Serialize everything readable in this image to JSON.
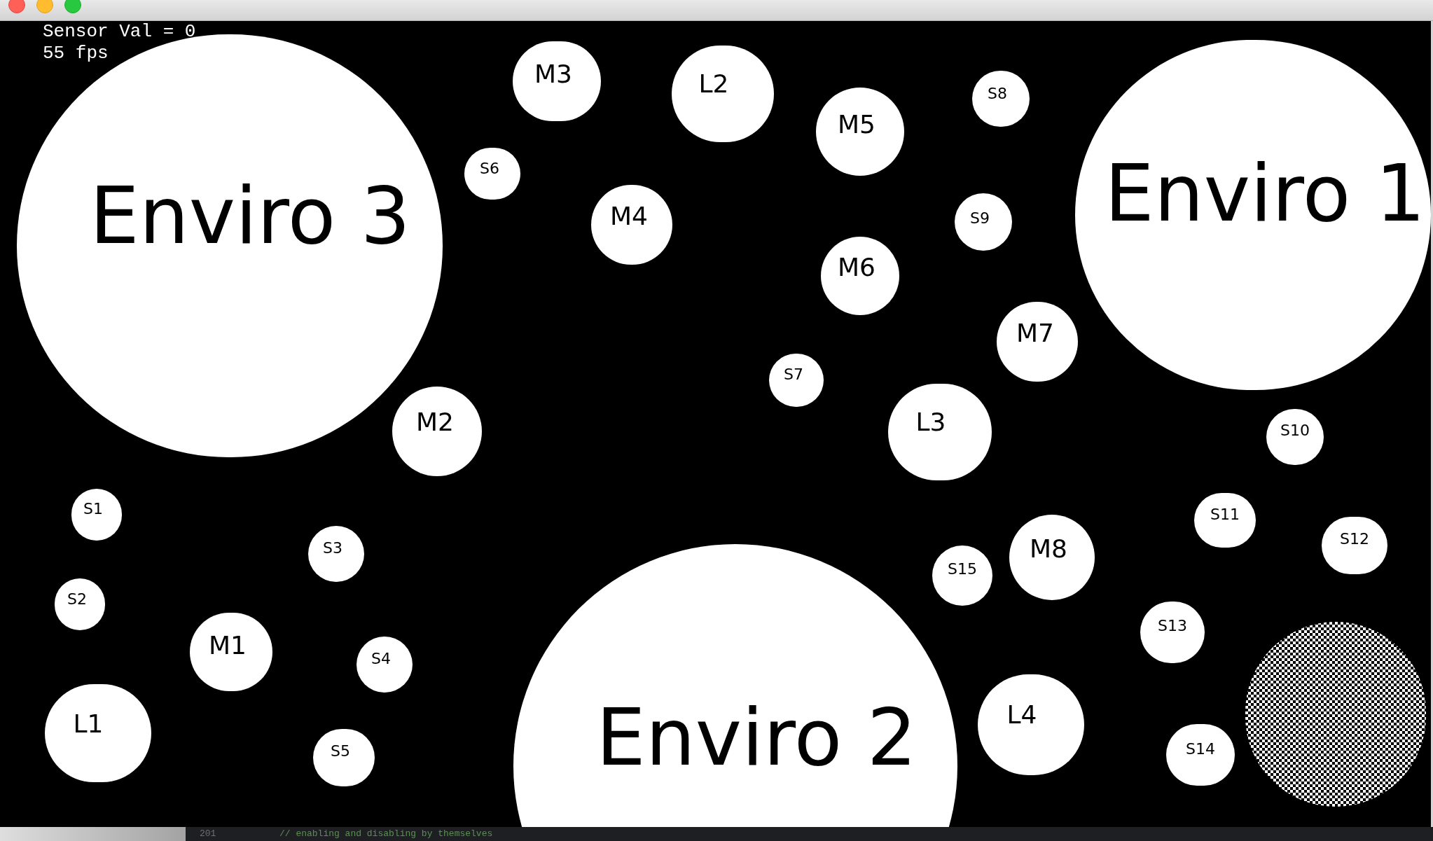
{
  "sketch": {
    "overlay_lines": [
      "Sensor Val = 0",
      "55 fps"
    ],
    "circles": [
      {
        "label": "M3",
        "kind": "medium"
      },
      {
        "label": "L2",
        "kind": "medium"
      },
      {
        "label": "S8",
        "kind": "small"
      },
      {
        "label": "M5",
        "kind": "medium"
      },
      {
        "label": "S6",
        "kind": "small"
      },
      {
        "label": "Enviro 3",
        "kind": "large"
      },
      {
        "label": "M4",
        "kind": "medium"
      },
      {
        "label": "S9",
        "kind": "small"
      },
      {
        "label": "Enviro 1",
        "kind": "large"
      },
      {
        "label": "M6",
        "kind": "medium"
      },
      {
        "label": "M7",
        "kind": "medium"
      },
      {
        "label": "S7",
        "kind": "small"
      },
      {
        "label": "M2",
        "kind": "medium"
      },
      {
        "label": "L3",
        "kind": "medium"
      },
      {
        "label": "S10",
        "kind": "small"
      },
      {
        "label": "S1",
        "kind": "small"
      },
      {
        "label": "S11",
        "kind": "small"
      },
      {
        "label": "S3",
        "kind": "small"
      },
      {
        "label": "M8",
        "kind": "medium"
      },
      {
        "label": "S12",
        "kind": "small"
      },
      {
        "label": "S15",
        "kind": "small"
      },
      {
        "label": "S2",
        "kind": "small"
      },
      {
        "label": "S13",
        "kind": "small"
      },
      {
        "label": "M1",
        "kind": "medium"
      },
      {
        "label": "S4",
        "kind": "small"
      },
      {
        "label": "L1",
        "kind": "medium"
      },
      {
        "label": "S5",
        "kind": "small"
      },
      {
        "label": "Enviro 2",
        "kind": "large"
      },
      {
        "label": "L4",
        "kind": "medium"
      },
      {
        "label": "S14",
        "kind": "small"
      },
      {
        "kind": "checkered"
      }
    ]
  },
  "editor": {
    "line_number": "201",
    "code": "// enabling and disabling by themselves"
  }
}
